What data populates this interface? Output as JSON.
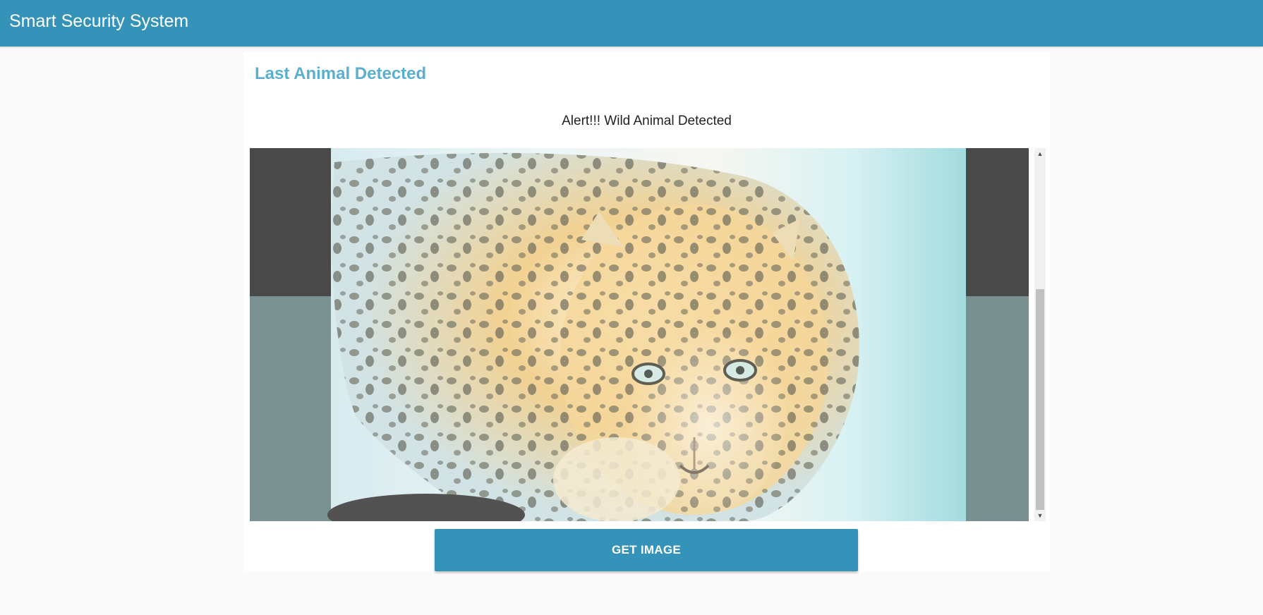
{
  "app": {
    "title": "Smart Security System"
  },
  "card": {
    "heading": "Last Animal Detected",
    "alert": "Alert!!! Wild Animal Detected",
    "image_subject": "leopard-photo",
    "button_label": "GET IMAGE"
  },
  "scrollbar": {
    "up_glyph": "▲",
    "down_glyph": "▼"
  },
  "colors": {
    "header_bg": "#3592b8",
    "heading_text": "#5aaed0",
    "button_bg": "#3592b8",
    "page_bg": "#fafafa"
  }
}
